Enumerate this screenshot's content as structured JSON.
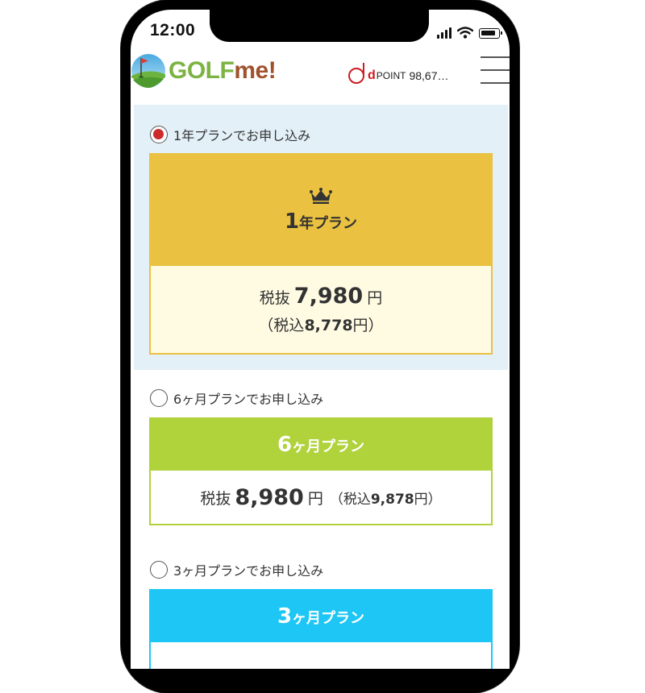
{
  "status_bar": {
    "time": "12:00"
  },
  "header": {
    "logo": {
      "prefix": "GOLF",
      "suffix": "me!"
    },
    "dpoint": {
      "brand": "d",
      "label": "POINT",
      "value": "98,67…"
    }
  },
  "plans": [
    {
      "radio_label": "1年プランでお申し込み",
      "selected": true,
      "title_num": "1",
      "title_rest": "年プラン",
      "price_label": "税抜",
      "price": "7,980",
      "unit": "円",
      "tax_open": "（税込",
      "tax_value": "8,778",
      "tax_close": "円）",
      "color": "#eac140",
      "border": "#eac140",
      "body_bg": "#fffbe3"
    },
    {
      "radio_label": "6ヶ月プランでお申し込み",
      "selected": false,
      "title_num": "6",
      "title_rest": "ヶ月プラン",
      "price_label": "税抜",
      "price": "8,980",
      "unit": "円",
      "tax_open": "（税込",
      "tax_value": "9,878",
      "tax_close": "円）",
      "color": "#b0d23b",
      "border": "#b0d23b",
      "body_bg": "#ffffff"
    },
    {
      "radio_label": "3ヶ月プランでお申し込み",
      "selected": false,
      "title_num": "3",
      "title_rest": "ヶ月プラン",
      "color": "#1ec6f6",
      "border": "#1ec6f6",
      "body_bg": "#ffffff"
    }
  ],
  "icons": {
    "crown": "crown-icon",
    "menu": "hamburger-menu-icon",
    "radio": "radio-button-icon"
  }
}
